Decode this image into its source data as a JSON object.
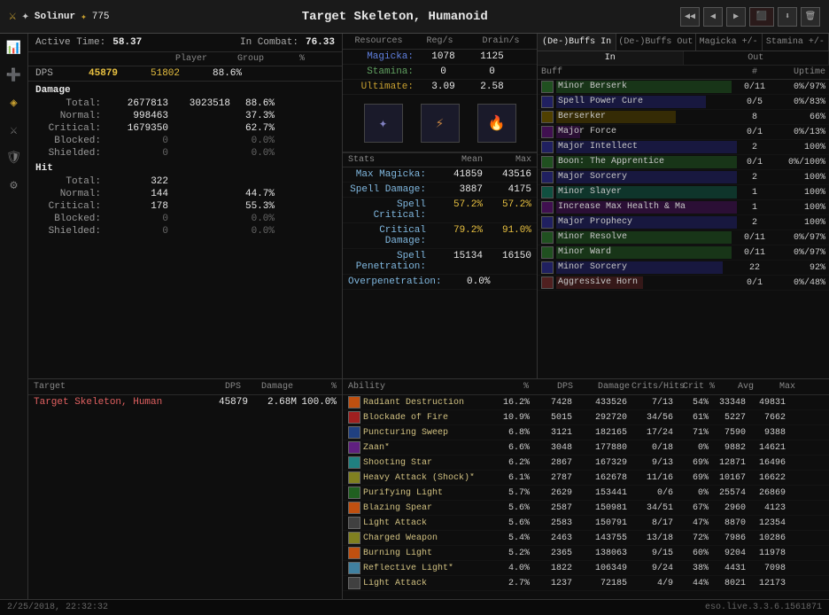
{
  "header": {
    "title": "Target Skeleton, Humanoid",
    "player": "Solinur",
    "level": "775"
  },
  "active_time": {
    "label": "Active Time:",
    "value": "58.37",
    "in_combat_label": "In Combat:",
    "in_combat_value": "76.33"
  },
  "columns": {
    "player": "Player",
    "group": "Group",
    "pct": "%"
  },
  "dps": {
    "label": "DPS",
    "player": "45879",
    "group": "51802",
    "pct": "88.6%"
  },
  "damage": {
    "label": "Damage",
    "total_label": "Total:",
    "total_player": "2677813",
    "total_group": "3023518",
    "total_pct": "88.6%",
    "normal_label": "Normal:",
    "normal_player": "998463",
    "normal_pct": "37.3%",
    "critical_label": "Critical:",
    "critical_player": "1679350",
    "critical_pct": "62.7%",
    "blocked_label": "Blocked:",
    "blocked_player": "0",
    "blocked_pct": "0.0%",
    "shielded_label": "Shielded:",
    "shielded_player": "0",
    "shielded_pct": "0.0%"
  },
  "hit": {
    "label": "Hit",
    "total_label": "Total:",
    "total_val": "322",
    "normal_label": "Normal:",
    "normal_val": "144",
    "normal_pct": "44.7%",
    "critical_label": "Critical:",
    "critical_val": "178",
    "critical_pct": "55.3%",
    "blocked_label": "Blocked:",
    "blocked_val": "0",
    "blocked_pct": "0.0%",
    "shielded_label": "Shielded:",
    "shielded_val": "0",
    "shielded_pct": "0.0%"
  },
  "resources": {
    "title": "Resources",
    "reg_label": "Reg/s",
    "drain_label": "Drain/s",
    "magicka_label": "Magicka:",
    "magicka_reg": "1078",
    "magicka_drain": "1125",
    "stamina_label": "Stamina:",
    "stamina_reg": "0",
    "stamina_drain": "0",
    "ultimate_label": "Ultimate:",
    "ultimate_reg": "3.09",
    "ultimate_drain": "2.58"
  },
  "stats": {
    "title": "Stats",
    "mean_label": "Mean",
    "max_label": "Max",
    "rows": [
      {
        "label": "Max Magicka:",
        "mean": "41859",
        "max": "43516"
      },
      {
        "label": "Spell Damage:",
        "mean": "3887",
        "max": "4175"
      },
      {
        "label": "Spell Critical:",
        "mean": "57.2%",
        "max": "57.2%"
      },
      {
        "label": "Critical Damage:",
        "mean": "79.2%",
        "max": "91.0%"
      },
      {
        "label": "Spell Penetration:",
        "mean": "15134",
        "max": "16150"
      },
      {
        "label": "Overpenetration:",
        "mean": "0.0%",
        "max": ""
      }
    ]
  },
  "buffs_tabs": {
    "debuffs_in": "(De-)Buffs In",
    "debuffs_out": "(De-)Buffs Out",
    "magicka": "Magicka +/-",
    "stamina": "Stamina +/-"
  },
  "buffs_sub": {
    "in_label": "In",
    "out_label": "Out"
  },
  "buffs_cols": {
    "buff": "Buff",
    "num": "#",
    "uptime": "Uptime"
  },
  "buffs": [
    {
      "name": "Minor Berserk",
      "num": "0/11",
      "uptime": "0%/97%",
      "color": "bar-green",
      "width": "97"
    },
    {
      "name": "Spell Power Cure",
      "num": "0/5",
      "uptime": "0%/83%",
      "color": "bar-blue",
      "width": "83"
    },
    {
      "name": "Berserker",
      "num": "8",
      "uptime": "66%",
      "color": "bar-yellow",
      "width": "66"
    },
    {
      "name": "Major Force",
      "num": "0/1",
      "uptime": "0%/13%",
      "color": "bar-purple",
      "width": "13"
    },
    {
      "name": "Major Intellect",
      "num": "2",
      "uptime": "100%",
      "color": "bar-blue",
      "width": "100"
    },
    {
      "name": "Boon: The Apprentice",
      "num": "0/1",
      "uptime": "0%/100%",
      "color": "bar-green",
      "width": "100"
    },
    {
      "name": "Major Sorcery",
      "num": "2",
      "uptime": "100%",
      "color": "bar-blue",
      "width": "100"
    },
    {
      "name": "Minor Slayer",
      "num": "1",
      "uptime": "100%",
      "color": "bar-teal",
      "width": "100"
    },
    {
      "name": "Increase Max Health & Ma",
      "num": "1",
      "uptime": "100%",
      "color": "bar-purple",
      "width": "100"
    },
    {
      "name": "Major Prophecy",
      "num": "2",
      "uptime": "100%",
      "color": "bar-blue",
      "width": "100"
    },
    {
      "name": "Minor Resolve",
      "num": "0/11",
      "uptime": "0%/97%",
      "color": "bar-green",
      "width": "97"
    },
    {
      "name": "Minor Ward",
      "num": "0/11",
      "uptime": "0%/97%",
      "color": "bar-green",
      "width": "97"
    },
    {
      "name": "Minor Sorcery",
      "num": "22",
      "uptime": "92%",
      "color": "bar-blue",
      "width": "92"
    },
    {
      "name": "Aggressive Horn",
      "num": "0/1",
      "uptime": "0%/48%",
      "color": "bar-red",
      "width": "48"
    }
  ],
  "target": {
    "header": {
      "target": "Target",
      "dps": "DPS",
      "damage": "Damage",
      "pct": "%"
    },
    "rows": [
      {
        "name": "Target Skeleton, Human",
        "dps": "45879",
        "damage": "2.68M",
        "pct": "100.0%"
      }
    ]
  },
  "abilities": {
    "header": {
      "ability": "Ability",
      "pct": "%",
      "dps": "DPS",
      "damage": "Damage",
      "crits": "Crits/Hits",
      "crit_pct": "Crit %",
      "avg": "Avg",
      "max": "Max"
    },
    "rows": [
      {
        "name": "Radiant Destruction",
        "pct": "16.2%",
        "dps": "7428",
        "damage": "433526",
        "crits": "7/13",
        "crit_pct": "54%",
        "avg": "33348",
        "max": "49831",
        "color": "sq-orange"
      },
      {
        "name": "Blockade of Fire",
        "pct": "10.9%",
        "dps": "5015",
        "damage": "292720",
        "crits": "34/56",
        "crit_pct": "61%",
        "avg": "5227",
        "max": "7662",
        "color": "sq-red"
      },
      {
        "name": "Puncturing Sweep",
        "pct": "6.8%",
        "dps": "3121",
        "damage": "182165",
        "crits": "17/24",
        "crit_pct": "71%",
        "avg": "7590",
        "max": "9388",
        "color": "sq-blue"
      },
      {
        "name": "Zaan*",
        "pct": "6.6%",
        "dps": "3048",
        "damage": "177880",
        "crits": "0/18",
        "crit_pct": "0%",
        "avg": "9882",
        "max": "14621",
        "color": "sq-purple"
      },
      {
        "name": "Shooting Star",
        "pct": "6.2%",
        "dps": "2867",
        "damage": "167329",
        "crits": "9/13",
        "crit_pct": "69%",
        "avg": "12871",
        "max": "16496",
        "color": "sq-cyan"
      },
      {
        "name": "Heavy Attack (Shock)*",
        "pct": "6.1%",
        "dps": "2787",
        "damage": "162678",
        "crits": "11/16",
        "crit_pct": "69%",
        "avg": "10167",
        "max": "16622",
        "color": "sq-yellow"
      },
      {
        "name": "Purifying Light",
        "pct": "5.7%",
        "dps": "2629",
        "damage": "153441",
        "crits": "0/6",
        "crit_pct": "0%",
        "avg": "25574",
        "max": "26869",
        "color": "sq-green"
      },
      {
        "name": "Blazing Spear",
        "pct": "5.6%",
        "dps": "2587",
        "damage": "150981",
        "crits": "34/51",
        "crit_pct": "67%",
        "avg": "2960",
        "max": "4123",
        "color": "sq-orange"
      },
      {
        "name": "Light Attack",
        "pct": "5.6%",
        "dps": "2583",
        "damage": "150791",
        "crits": "8/17",
        "crit_pct": "47%",
        "avg": "8870",
        "max": "12354",
        "color": "sq-gray"
      },
      {
        "name": "Charged Weapon",
        "pct": "5.4%",
        "dps": "2463",
        "damage": "143755",
        "crits": "13/18",
        "crit_pct": "72%",
        "avg": "7986",
        "max": "10286",
        "color": "sq-yellow"
      },
      {
        "name": "Burning Light",
        "pct": "5.2%",
        "dps": "2365",
        "damage": "138063",
        "crits": "9/15",
        "crit_pct": "60%",
        "avg": "9204",
        "max": "11978",
        "color": "sq-orange"
      },
      {
        "name": "Reflective Light*",
        "pct": "4.0%",
        "dps": "1822",
        "damage": "106349",
        "crits": "9/24",
        "crit_pct": "38%",
        "avg": "4431",
        "max": "7098",
        "color": "sq-lightblue"
      },
      {
        "name": "Light Attack",
        "pct": "2.7%",
        "dps": "1237",
        "damage": "72185",
        "crits": "4/9",
        "crit_pct": "44%",
        "avg": "8021",
        "max": "12173",
        "color": "sq-gray"
      }
    ]
  },
  "footer": {
    "datetime": "2/25/2018, 22:32:32",
    "version": "eso.live.3.3.6.1561871"
  }
}
